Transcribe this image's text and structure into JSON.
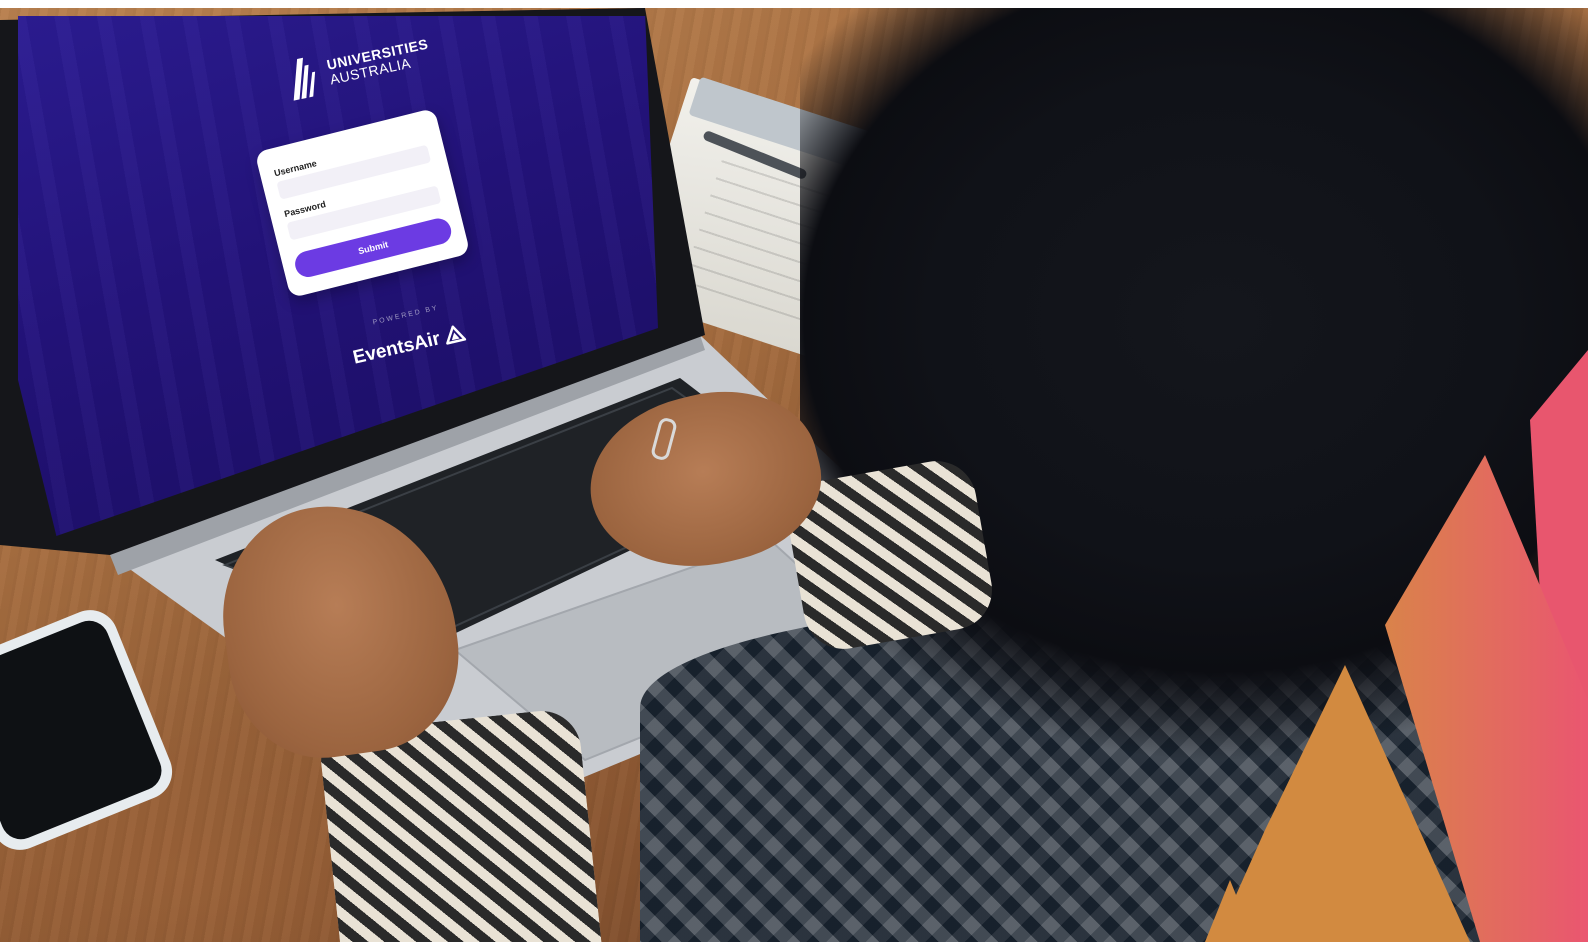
{
  "login_screen": {
    "logo_line_1": "UNIVERSITIES",
    "logo_line_2": "AUSTRALIA",
    "username_label": "Username",
    "password_label": "Password",
    "submit_label": "Submit",
    "powered_by": "POWERED BY",
    "eventsair_name": "EventsAir"
  },
  "icons": {
    "ua_logo": "universities-australia-logo-icon",
    "eventsair_logo": "eventsair-logo-icon"
  },
  "colors": {
    "screen_background": "#221277",
    "submit_button": "#6c3be3",
    "accent_pink": "#e8566e",
    "accent_orange": "#d4913f"
  }
}
